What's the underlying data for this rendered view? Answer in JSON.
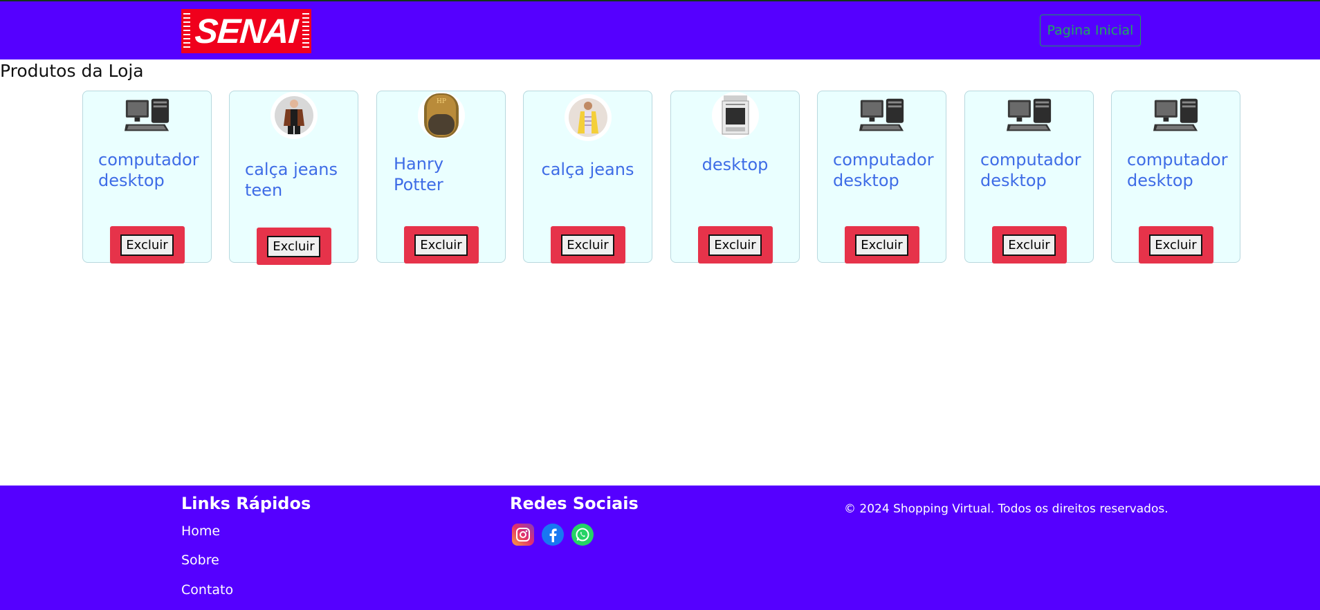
{
  "header": {
    "logo_text": "SENAI",
    "home_button": "Pagina Inicial"
  },
  "page": {
    "title": "Produtos da Loja"
  },
  "products": [
    {
      "name": "computador desktop",
      "image": "computer-icon",
      "delete_label": "Excluir"
    },
    {
      "name": "calça jeans teen",
      "image": "jacket-photo",
      "delete_label": "Excluir"
    },
    {
      "name": "Hanry Potter",
      "image": "book-cover",
      "delete_label": "Excluir"
    },
    {
      "name": "calça jeans",
      "image": "dress-photo",
      "delete_label": "Excluir"
    },
    {
      "name": "desktop",
      "image": "stove-photo",
      "delete_label": "Excluir"
    },
    {
      "name": "computador desktop",
      "image": "computer-icon",
      "delete_label": "Excluir"
    },
    {
      "name": "computador desktop",
      "image": "computer-icon",
      "delete_label": "Excluir"
    },
    {
      "name": "computador desktop",
      "image": "computer-icon",
      "delete_label": "Excluir"
    }
  ],
  "footer": {
    "links_title": "Links Rápidos",
    "links": [
      "Home",
      "Sobre",
      "Contato"
    ],
    "social_title": "Redes Sociais",
    "socials": [
      "instagram-icon",
      "facebook-icon",
      "whatsapp-icon"
    ],
    "copyright": "© 2024 Shopping Virtual. Todos os direitos reservados."
  },
  "colors": {
    "header_bg": "#5500ff",
    "card_bg": "#eaffff",
    "card_title": "#3e6ce6",
    "delete_bg": "#e6334a",
    "home_button": "#1fa860"
  }
}
